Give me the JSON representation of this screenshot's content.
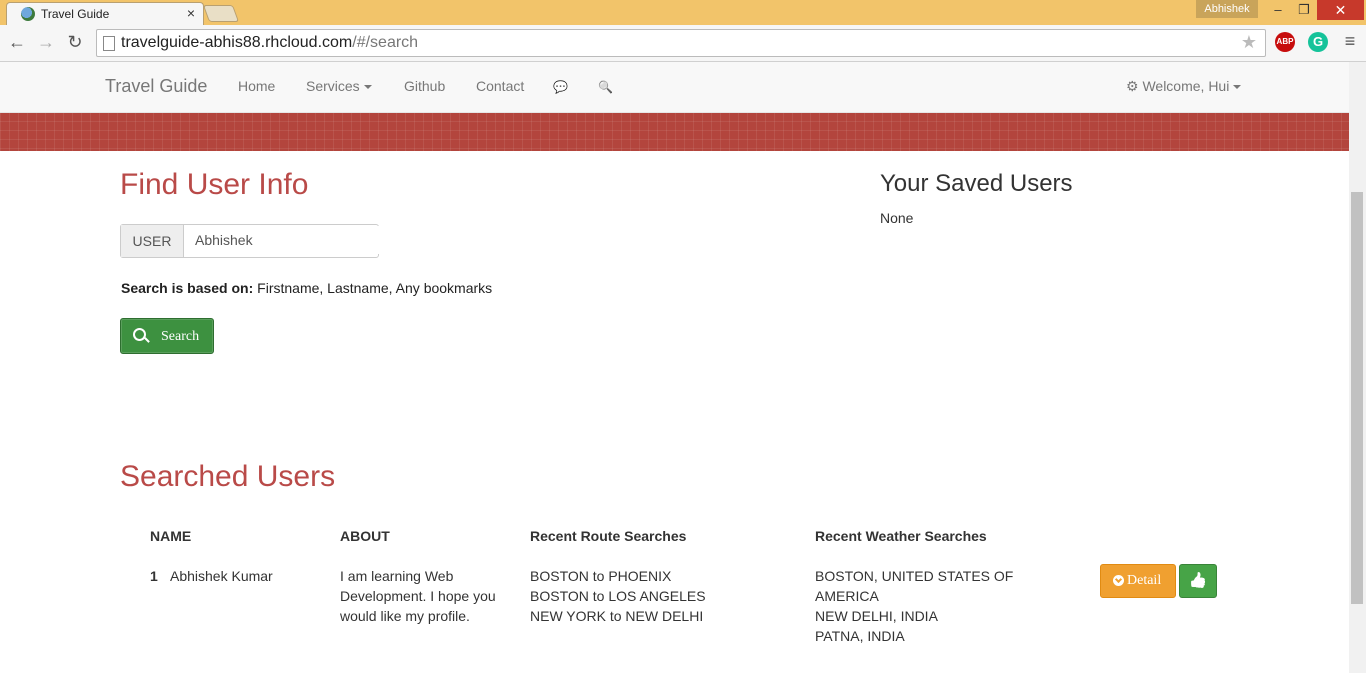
{
  "browser": {
    "tab_title": "Travel Guide",
    "tab_close": "×",
    "profile_name": "Abhishek",
    "window_buttons": {
      "minimize": "–",
      "restore": "❐",
      "close": "✕"
    },
    "url_host": "travelguide-abhis88.rhcloud.com",
    "url_path": "/#/search",
    "back": "←",
    "forward": "→",
    "reload": "↻",
    "star": "★",
    "abp_label": "ABP",
    "grammarly_label": "G",
    "menu": "≡"
  },
  "navbar": {
    "brand": "Travel Guide",
    "home": "Home",
    "services": "Services",
    "github": "Github",
    "contact": "Contact",
    "chat_icon": "💬",
    "search_icon": "🔍",
    "welcome": "Welcome, Hui",
    "gear_icon": "⚙"
  },
  "find": {
    "title": "Find User Info",
    "addon_label": "USER",
    "input_value": "Abhishek",
    "basis_label": "Search is based on:",
    "basis_text": "Firstname, Lastname, Any bookmarks",
    "search_button": "Search"
  },
  "saved": {
    "title": "Your Saved Users",
    "value": "None"
  },
  "searched": {
    "title": "Searched Users",
    "headers": {
      "name": "NAME",
      "about": "ABOUT",
      "routes": "Recent Route Searches",
      "weather": "Recent Weather Searches"
    },
    "rows": [
      {
        "index": "1",
        "name": "Abhishek Kumar",
        "about": [
          "I am learning Web",
          "Development. I hope you",
          "would like my profile."
        ],
        "routes": [
          "BOSTON to PHOENIX",
          "BOSTON to LOS ANGELES",
          "NEW YORK to NEW DELHI"
        ],
        "weather": [
          "BOSTON, UNITED STATES OF",
          "AMERICA",
          "NEW DELHI, INDIA",
          "PATNA, INDIA"
        ],
        "detail_button": "Detail",
        "like_icon": "👍"
      }
    ]
  }
}
